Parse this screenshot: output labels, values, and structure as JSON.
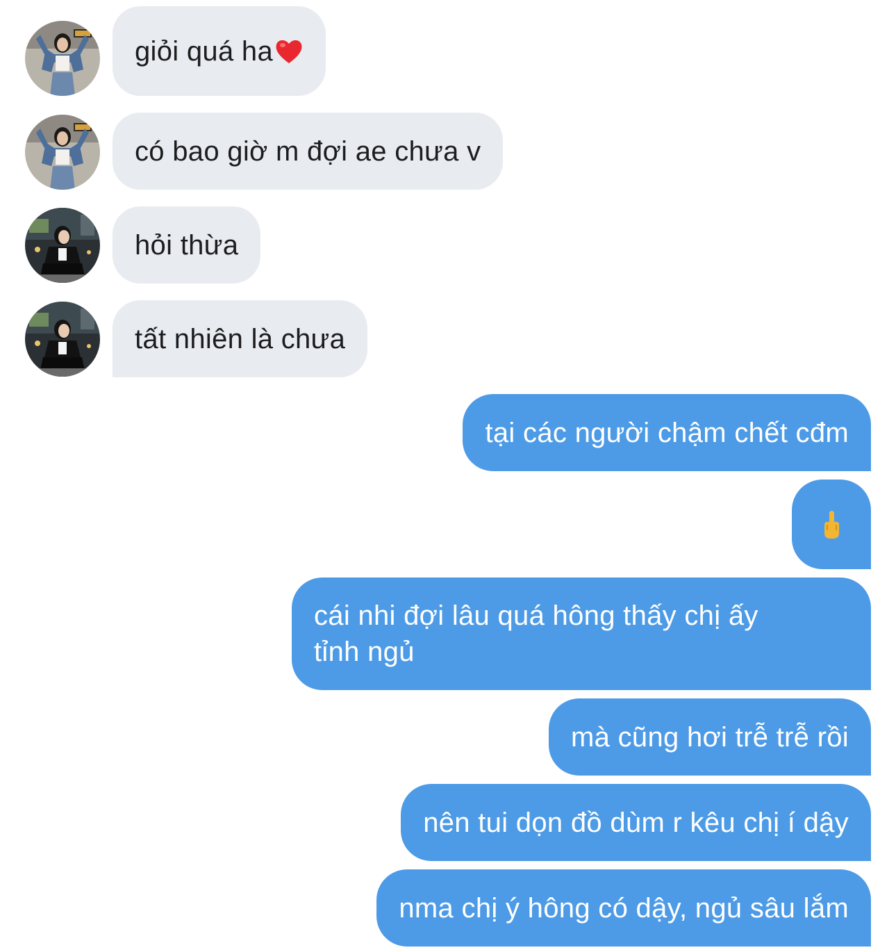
{
  "conversation": {
    "incoming": [
      {
        "text": "giỏi quá ha",
        "emoji": "heart-emoji",
        "avatar": "avatar-denim-girl"
      },
      {
        "text": "có bao giờ m đợi ae chưa v",
        "avatar": "avatar-denim-girl"
      },
      {
        "text": "hỏi thừa",
        "avatar": "avatar-night-girl"
      },
      {
        "text": "tất nhiên là chưa",
        "avatar": "avatar-night-girl"
      }
    ],
    "outgoing": [
      {
        "text": "tại các người chậm chết cđm"
      },
      {
        "text": "",
        "emoji": "middle-finger-emoji"
      },
      {
        "line1": "cái nhi đợi lâu quá hông thấy chị ấy",
        "line2": "tỉnh ngủ"
      },
      {
        "text": "mà cũng hơi trễ trễ rồi"
      },
      {
        "text": "nên tui dọn đồ dùm r kêu chị í dậy"
      },
      {
        "text": "nma chị ý hông có dậy, ngủ sâu lắm"
      }
    ]
  },
  "colors": {
    "incoming_bubble": "#e8ebef",
    "outgoing_bubble": "#4d9be6",
    "incoming_text": "#1d1d1f",
    "outgoing_text": "#ffffff"
  }
}
